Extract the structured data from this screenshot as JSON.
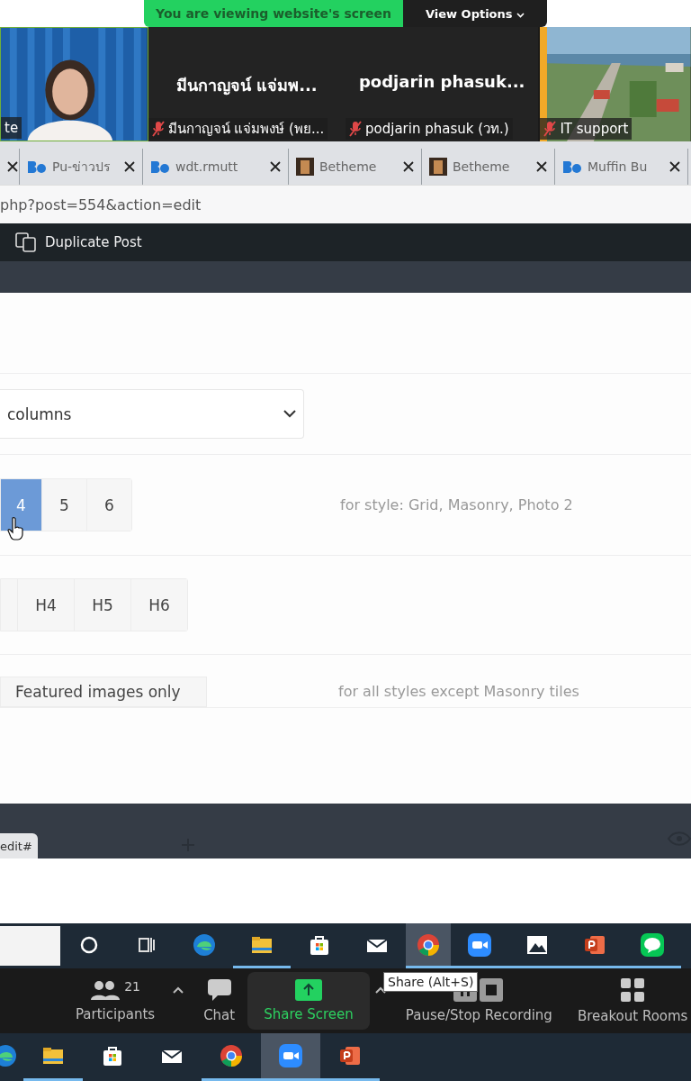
{
  "share_banner": {
    "message": "You are viewing website's screen",
    "options_label": "View Options"
  },
  "video_strip": [
    {
      "kind": "video",
      "label": "te",
      "muted": false
    },
    {
      "kind": "name",
      "display_name": "มีนกาญจน์ แจ่มพ...",
      "label": "มีนกาญจน์ แจ่มพงษ์ (พย...",
      "muted": true
    },
    {
      "kind": "name",
      "display_name": "podjarin  phasuk...",
      "label": "podjarin phasuk (วท.)",
      "muted": true
    },
    {
      "kind": "video",
      "label": "IT support",
      "muted": true
    }
  ],
  "browser": {
    "tabs": [
      {
        "kind": "cut"
      },
      {
        "kind": "be",
        "title": "Pu-ข่าวปร"
      },
      {
        "kind": "be",
        "title": "wdt.rmutt"
      },
      {
        "title": "Betheme"
      },
      {
        "title": "Betheme"
      },
      {
        "kind": "be",
        "title": "Muffin Bu"
      }
    ],
    "address": "php?post=554&action=edit"
  },
  "admin_bar": {
    "item": "Duplicate Post"
  },
  "panel": {
    "select_value": "columns",
    "column_options": [
      {
        "label": "4",
        "selected": true
      },
      {
        "label": "5",
        "selected": false
      },
      {
        "label": "6",
        "selected": false
      }
    ],
    "column_hint": "for style: Grid, Masonry, Photo 2",
    "heading_options": [
      {
        "label": "H4",
        "selected": false
      },
      {
        "label": "H5",
        "selected": false
      },
      {
        "label": "H6",
        "selected": false
      }
    ],
    "image_button": "Featured images only",
    "image_hint": "for all styles except Masonry tiles"
  },
  "builder_footer": {
    "tab": "edit#"
  },
  "taskbar_top": [
    {
      "kind": "cortana",
      "running": false,
      "active": false
    },
    {
      "kind": "taskview",
      "running": false,
      "active": false
    },
    {
      "kind": "edge",
      "running": false,
      "active": false
    },
    {
      "kind": "folder",
      "running": true,
      "active": false
    },
    {
      "kind": "store",
      "running": false,
      "active": false
    },
    {
      "kind": "mail",
      "running": false,
      "active": false
    },
    {
      "kind": "chrome",
      "running": true,
      "active": true
    },
    {
      "kind": "zoom",
      "running": true,
      "active": false
    },
    {
      "kind": "photos",
      "running": true,
      "active": false
    },
    {
      "kind": "powerpoint",
      "running": true,
      "active": false
    },
    {
      "kind": "line",
      "running": true,
      "active": false
    }
  ],
  "zoom_toolbar": [
    {
      "kind": "participants",
      "label": "Participants",
      "count": "21",
      "caret": true,
      "highlighted": false
    },
    {
      "kind": "chat",
      "label": "Chat",
      "caret": false,
      "highlighted": false
    },
    {
      "kind": "share",
      "label": "Share Screen",
      "caret": true,
      "highlighted": true
    },
    {
      "kind": "record",
      "label": "Pause/Stop Recording",
      "caret": false,
      "highlighted": false
    },
    {
      "kind": "breakout",
      "label": "Breakout Rooms",
      "caret": false,
      "highlighted": false
    }
  ],
  "tooltip": "Share (Alt+S)",
  "taskbar_bottom": [
    {
      "kind": "edge",
      "running": false,
      "active": false
    },
    {
      "kind": "folder",
      "running": true,
      "active": false
    },
    {
      "kind": "store",
      "running": false,
      "active": false
    },
    {
      "kind": "mail",
      "running": false,
      "active": false
    },
    {
      "kind": "chrome",
      "running": true,
      "active": false
    },
    {
      "kind": "zoom",
      "running": true,
      "active": true
    },
    {
      "kind": "powerpoint",
      "running": true,
      "active": false
    }
  ]
}
